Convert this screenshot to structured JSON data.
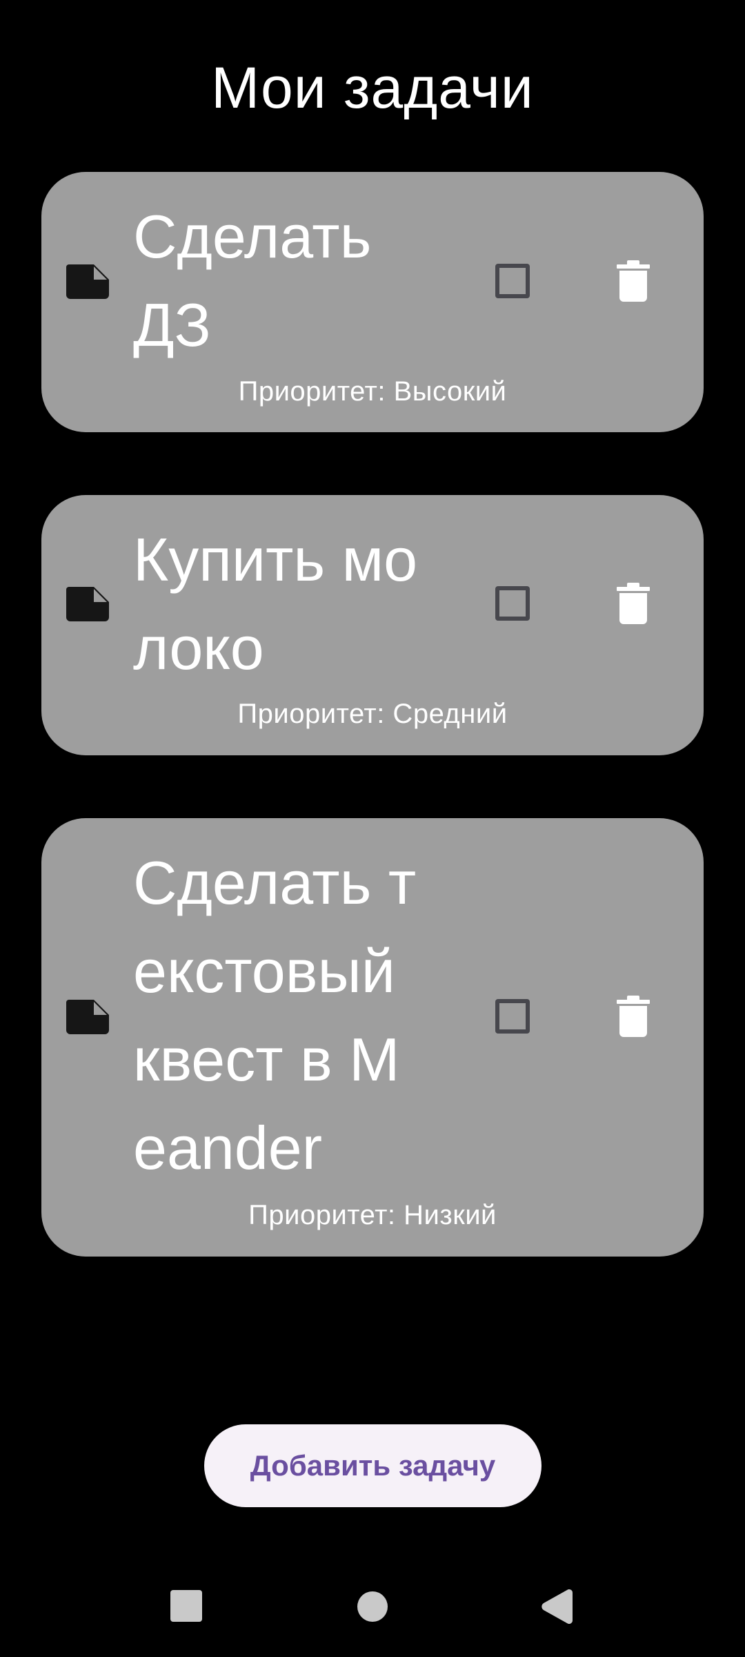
{
  "header": {
    "title": "Мои задачи"
  },
  "tasks": [
    {
      "title": "Сделать ДЗ",
      "priority": "Приоритет: Высокий",
      "checked": false
    },
    {
      "title": "Купить молоко",
      "priority": "Приоритет: Средний",
      "checked": false
    },
    {
      "title": "Сделать текстовый квест в Meander",
      "priority": "Приоритет: Низкий",
      "checked": false
    }
  ],
  "icons": {
    "task": "note-icon",
    "delete": "trash-icon",
    "checkbox": "checkbox-icon"
  },
  "actions": {
    "add_label": "Добавить задачу"
  },
  "system_nav": {
    "recents": "square-icon",
    "home": "circle-icon",
    "back": "triangle-back-icon"
  },
  "colors": {
    "background": "#000000",
    "card": "#9e9e9e",
    "button_bg": "#f6f1f8",
    "button_text": "#6a4fa0",
    "checkbox_border": "#47474d"
  }
}
